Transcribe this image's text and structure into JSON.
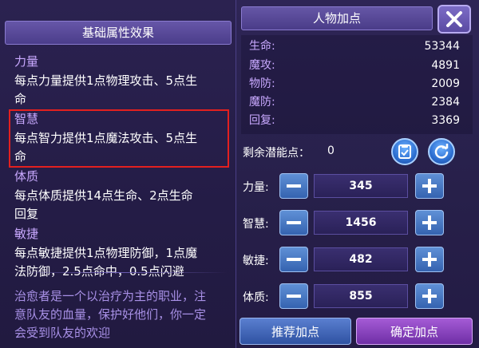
{
  "left_panel": {
    "title": "基础属性效果",
    "attributes": [
      {
        "name": "力量",
        "lines": [
          "每点力量提供1点物理攻击、5点生",
          "命"
        ]
      },
      {
        "name": "智慧",
        "lines": [
          "每点智力提供1点魔法攻击、5点生",
          "命"
        ]
      },
      {
        "name": "体质",
        "lines": [
          "每点体质提供14点生命、2点生命",
          "回复"
        ]
      },
      {
        "name": "敏捷",
        "lines": [
          "每点敏捷提供1点物理防御，1点魔",
          "法防御，2.5点命中，0.5点闪避"
        ]
      }
    ],
    "footer_lines": [
      "治愈者是一个以治疗为主的职业，注",
      "意队友的血量，保护好他们，你一定",
      "会受到队友的欢迎"
    ]
  },
  "right_panel": {
    "title": "人物加点",
    "stats": [
      {
        "label": "生命:",
        "value": "53344"
      },
      {
        "label": "魔攻:",
        "value": "4891"
      },
      {
        "label": "物防:",
        "value": "2009"
      },
      {
        "label": "魔防:",
        "value": "2384"
      },
      {
        "label": "回复:",
        "value": "3369"
      }
    ],
    "remaining_label": "剩余潜能点：",
    "remaining_value": "0",
    "attributes": [
      {
        "label": "力量:",
        "value": "345"
      },
      {
        "label": "智慧:",
        "value": "1456"
      },
      {
        "label": "敏捷:",
        "value": "482"
      },
      {
        "label": "体质:",
        "value": "855"
      }
    ],
    "recommend_button": "推荐加点",
    "confirm_button": "确定加点"
  },
  "icons": {
    "close": "close-icon",
    "save": "save-icon",
    "reset": "reset-icon",
    "minus": "minus-icon",
    "plus": "plus-icon"
  },
  "colors": {
    "attribute_name": "#c9a9ff",
    "highlight_border": "#e3201f",
    "confirm_button": "#8a3fc0",
    "recommend_button": "#3f66bb"
  }
}
